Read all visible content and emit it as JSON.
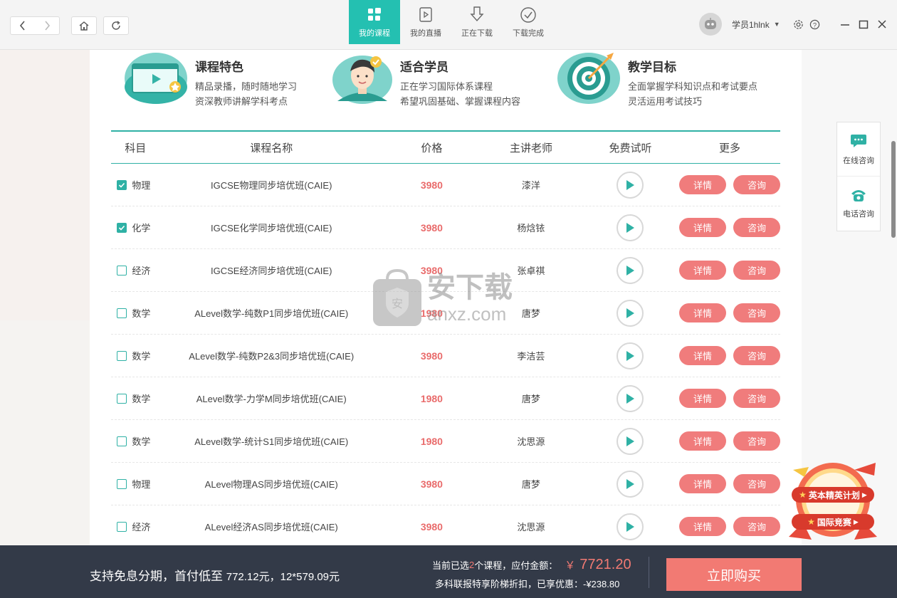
{
  "tabs": [
    {
      "label": "我的课程",
      "icon": "grid-icon",
      "active": true
    },
    {
      "label": "我的直播",
      "icon": "live-icon",
      "active": false
    },
    {
      "label": "正在下载",
      "icon": "download-icon",
      "active": false
    },
    {
      "label": "下载完成",
      "icon": "check-circle-icon",
      "active": false
    }
  ],
  "user": {
    "name": "学员1hlnk"
  },
  "features": [
    {
      "title": "课程特色",
      "lines": [
        "精品录播，随时随地学习",
        "资深教师讲解学科考点"
      ]
    },
    {
      "title": "适合学员",
      "lines": [
        "正在学习国际体系课程",
        "希望巩固基础、掌握课程内容"
      ]
    },
    {
      "title": "教学目标",
      "lines": [
        "全面掌握学科知识点和考试要点",
        "灵活运用考试技巧"
      ]
    }
  ],
  "table": {
    "headers": [
      "科目",
      "课程名称",
      "价格",
      "主讲老师",
      "免费试听",
      "更多"
    ],
    "detail_label": "详情",
    "consult_label": "咨询",
    "rows": [
      {
        "checked": true,
        "subject": "物理",
        "name": "IGCSE物理同步培优班(CAIE)",
        "price": "3980",
        "teacher": "漆洋"
      },
      {
        "checked": true,
        "subject": "化学",
        "name": "IGCSE化学同步培优班(CAIE)",
        "price": "3980",
        "teacher": "杨焓铱"
      },
      {
        "checked": false,
        "subject": "经济",
        "name": "IGCSE经济同步培优班(CAIE)",
        "price": "3980",
        "teacher": "张卓祺"
      },
      {
        "checked": false,
        "subject": "数学",
        "name": "ALevel数学-纯数P1同步培优班(CAIE)",
        "price": "1980",
        "teacher": "唐梦"
      },
      {
        "checked": false,
        "subject": "数学",
        "name": "ALevel数学-纯数P2&3同步培优班(CAIE)",
        "price": "3980",
        "teacher": "李洁芸"
      },
      {
        "checked": false,
        "subject": "数学",
        "name": "ALevel数学-力学M同步培优班(CAIE)",
        "price": "1980",
        "teacher": "唐梦"
      },
      {
        "checked": false,
        "subject": "数学",
        "name": "ALevel数学-统计S1同步培优班(CAIE)",
        "price": "1980",
        "teacher": "沈思源"
      },
      {
        "checked": false,
        "subject": "物理",
        "name": "ALevel物理AS同步培优班(CAIE)",
        "price": "3980",
        "teacher": "唐梦"
      },
      {
        "checked": false,
        "subject": "经济",
        "name": "ALevel经济AS同步培优班(CAIE)",
        "price": "3980",
        "teacher": "沈思源"
      }
    ]
  },
  "float": {
    "online": "在线咨询",
    "phone": "电话咨询"
  },
  "promo": {
    "line1": "英本精英计划",
    "line2": "国际竞赛"
  },
  "watermark": {
    "cn": "安下载",
    "en": "anxz.com"
  },
  "bottom": {
    "installment_text": "支持免息分期，首付低至",
    "installment_first": "772.12元，12*579.09元",
    "summary_prefix": "当前已选",
    "selected_count": "2",
    "summary_suffix": "个课程，应付金额：",
    "currency": "￥",
    "amount": "7721.20",
    "discount": "多科联报特享阶梯折扣，已享优惠：-¥238.80",
    "buy_label": "立即购买"
  },
  "colors": {
    "accent": "#24c0b1",
    "price": "#e96b6b",
    "pill": "#f07c7c",
    "buy": "#f27a73",
    "bottom_bg": "#333a48"
  }
}
